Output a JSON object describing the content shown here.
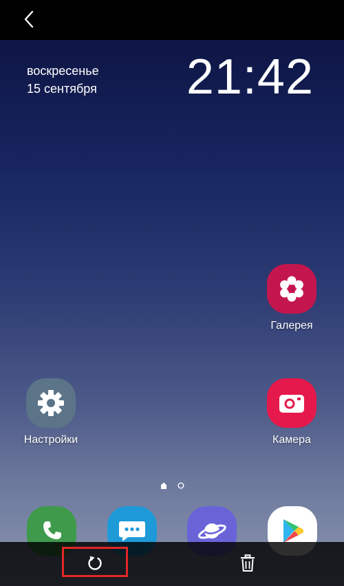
{
  "header": {
    "back_icon": "chevron-left-icon"
  },
  "lockscreen": {
    "day": "воскресенье",
    "date": "15 сентября",
    "time": "21:42"
  },
  "apps": {
    "gallery": {
      "label": "Галерея",
      "icon": "flower-icon",
      "color": "#c4164e"
    },
    "camera": {
      "label": "Камера",
      "icon": "camera-icon",
      "color": "#e5194b"
    },
    "settings": {
      "label": "Настройки",
      "icon": "gear-icon",
      "color": "#5b7488"
    }
  },
  "dock": [
    {
      "icon": "phone-icon",
      "color": "#3f9a4c"
    },
    {
      "icon": "message-icon",
      "color": "#1e9ad8"
    },
    {
      "icon": "planet-icon",
      "color": "#6a63d8"
    },
    {
      "icon": "play-store-icon",
      "color": "#ffffff"
    }
  ],
  "page_indicator": {
    "pages": 2,
    "current": 1
  },
  "bottom_bar": {
    "restore_icon": "rotate-ccw-icon",
    "delete_icon": "trash-icon",
    "highlight_color": "#e32626"
  }
}
